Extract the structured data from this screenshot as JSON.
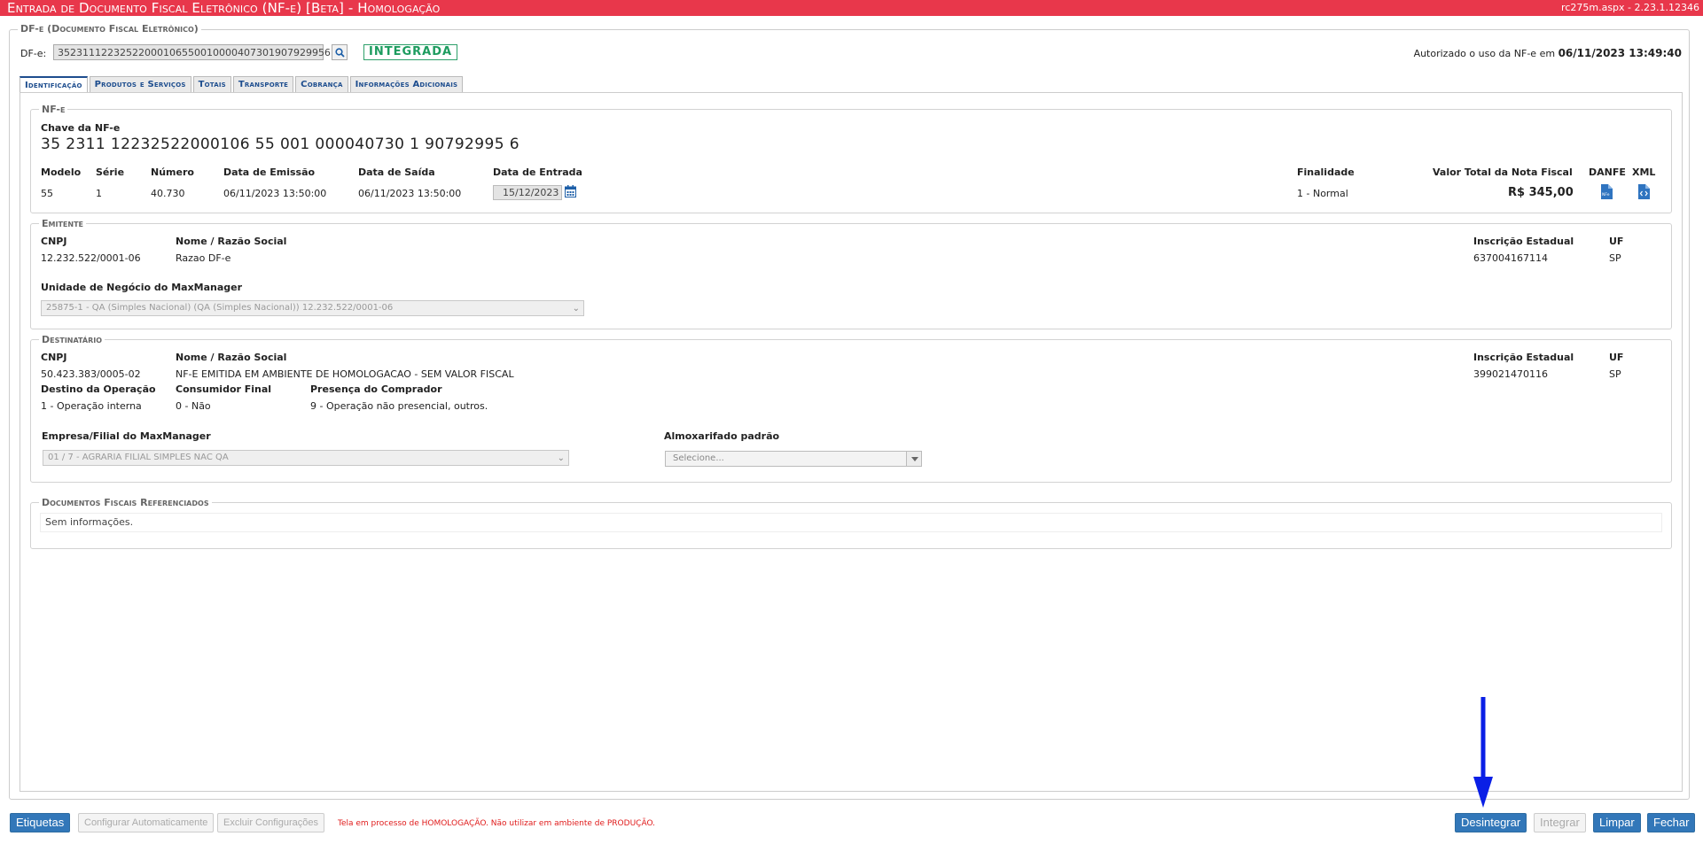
{
  "titlebar": {
    "title": "Entrada de Documento Fiscal Eletrônico (NF-e) [Beta]  - Homologação",
    "version": "rc275m.aspx - 2.23.1.12346"
  },
  "outer_legend": "DF-e (Documento Fiscal Eletrônico)",
  "dfe": {
    "label": "DF-e:",
    "value": "35231112232522000106550010000407301907929956",
    "status_badge": "INTEGRADA",
    "authorized_text": "Autorizado o uso da NF-e em",
    "authorized_date": "06/11/2023 13:49:40"
  },
  "tabs": [
    "Identificação",
    "Produtos e Serviços",
    "Totais",
    "Transporte",
    "Cobrança",
    "Informações Adicionais"
  ],
  "nfe": {
    "legend": "NF-e",
    "chave_label": "Chave da NF-e",
    "chave": "35 2311 12232522000106 55 001 000040730 1 90792995 6",
    "headers": {
      "modelo": "Modelo",
      "serie": "Série",
      "numero": "Número",
      "emissao": "Data de Emissão",
      "saida": "Data de Saída",
      "entrada": "Data de Entrada",
      "finalidade": "Finalidade",
      "valor": "Valor Total da Nota Fiscal",
      "danfe": "DANFE",
      "xml": "XML"
    },
    "values": {
      "modelo": "55",
      "serie": "1",
      "numero": "40.730",
      "emissao": "06/11/2023 13:50:00",
      "saida": "06/11/2023 13:50:00",
      "entrada": "15/12/2023",
      "finalidade": "1 - Normal",
      "valor": "R$ 345,00"
    }
  },
  "emitente": {
    "legend": "Emitente",
    "cnpj_label": "CNPJ",
    "cnpj": "12.232.522/0001-06",
    "nome_label": "Nome / Razão Social",
    "nome": "Razao DF-e",
    "ie_label": "Inscrição Estadual",
    "ie": "637004167114",
    "uf_label": "UF",
    "uf": "SP",
    "unidade_label": "Unidade de Negócio do MaxManager",
    "unidade_value": "25875-1 - QA (Simples Nacional) (QA (Simples Nacional)) 12.232.522/0001-06"
  },
  "destinatario": {
    "legend": "Destinatário",
    "cnpj_label": "CNPJ",
    "cnpj": "50.423.383/0005-02",
    "nome_label": "Nome / Razão Social",
    "nome": "NF-E EMITIDA EM AMBIENTE DE HOMOLOGACAO - SEM VALOR FISCAL",
    "ie_label": "Inscrição Estadual",
    "ie": "399021470116",
    "uf_label": "UF",
    "uf": "SP",
    "destino_label": "Destino da Operação",
    "destino": "1 - Operação interna",
    "consumidor_label": "Consumidor Final",
    "consumidor": "0 - Não",
    "presenca_label": "Presença do Comprador",
    "presenca": "9 - Operação não presencial, outros.",
    "empresa_label": "Empresa/Filial do MaxManager",
    "empresa_value": "01 / 7 - AGRARIA FILIAL SIMPLES NAC QA",
    "almox_label": "Almoxarifado padrão",
    "almox_placeholder": "Selecione..."
  },
  "referenciados": {
    "legend": "Documentos Fiscais Referenciados",
    "empty_text": "Sem informações."
  },
  "footer": {
    "etiquetas": "Etiquetas",
    "configurar": "Configurar Automaticamente",
    "excluir": "Excluir Configurações",
    "warning": "Tela em processo de HOMOLOGAÇÃO. Não utilizar em ambiente de PRODUÇÃO.",
    "desintegrar": "Desintegrar",
    "integrar": "Integrar",
    "limpar": "Limpar",
    "fechar": "Fechar"
  },
  "colors": {
    "titlebar": "#e8374b",
    "primary_button": "#3277b9",
    "status_green": "#1d9c5f",
    "annotation_arrow": "#0a1fe6"
  }
}
